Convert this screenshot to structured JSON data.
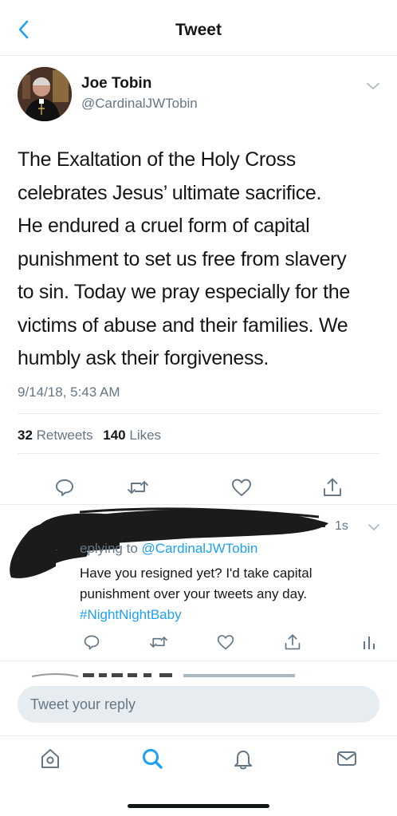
{
  "header": {
    "title": "Tweet",
    "back_icon": "chevron-left-icon"
  },
  "tweet": {
    "author_name": "Joe Tobin",
    "author_handle": "@CardinalJWTobin",
    "text_lines": [
      "The Exaltation of the Holy Cross",
      "celebrates Jesus’ ultimate sacrifice.",
      "He endured a cruel form of capital",
      "punishment to set us free from slavery",
      "to sin. Today we pray especially for the",
      "victims of abuse and their families. We",
      "humbly ask their forgiveness."
    ],
    "time": "9/14/18, 5:43 AM",
    "retweets_count": "32",
    "retweets_label": "Retweets",
    "likes_count": "140",
    "likes_label": "Likes",
    "actions": [
      "reply-icon",
      "retweet-icon",
      "like-icon",
      "share-icon"
    ]
  },
  "reply": {
    "time": "1s",
    "replying_prefix": "eplying to",
    "replying_handle": "@CardinalJWTobin",
    "text_line1": "Have you resigned yet? I'd take capital",
    "text_line2": "punishment over your tweets any day.",
    "hashtag": "#NightNightBaby"
  },
  "compose": {
    "placeholder": "Tweet your reply"
  },
  "tabbar": [
    "home-icon",
    "search-icon",
    "notifications-icon",
    "messages-icon"
  ],
  "colors": {
    "accent": "#1da1f2",
    "secondary_text": "#657786",
    "divider": "#e6ecf0"
  }
}
